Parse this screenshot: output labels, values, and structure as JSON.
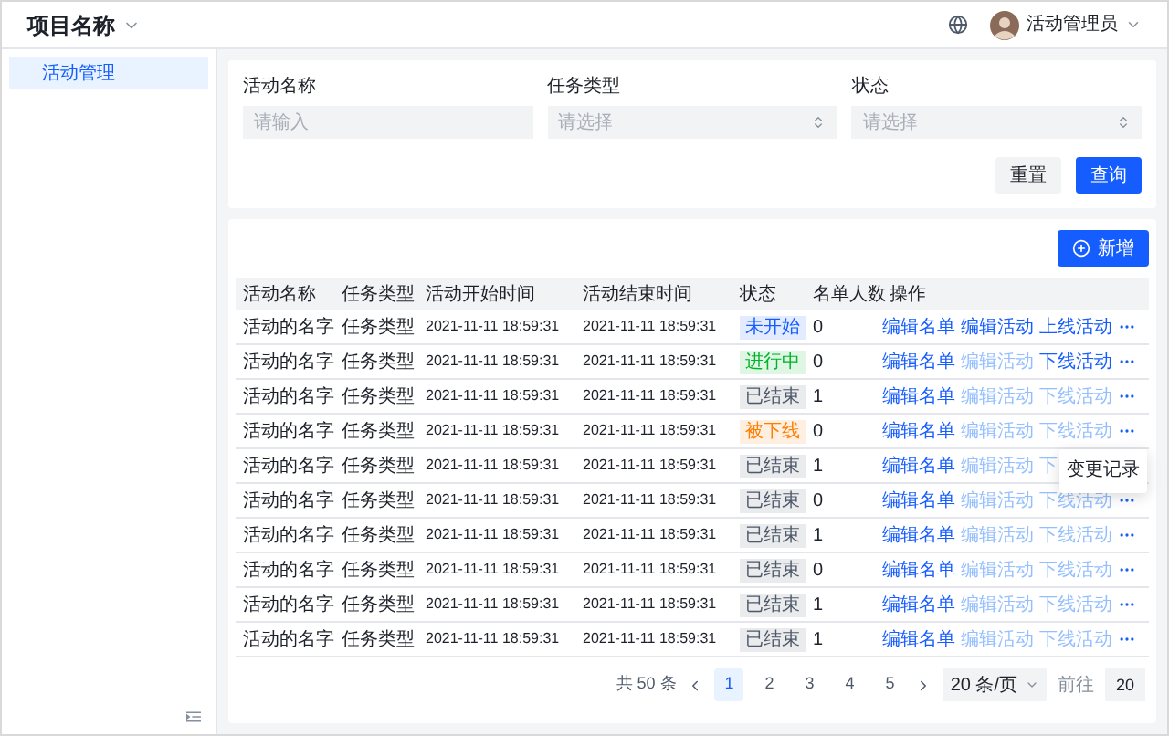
{
  "header": {
    "project": "项目名称",
    "user": "活动管理员"
  },
  "sidebar": {
    "items": [
      {
        "label": "活动管理",
        "selected": true
      }
    ]
  },
  "filters": {
    "fields": [
      {
        "label": "活动名称",
        "kind": "input",
        "placeholder": "请输入"
      },
      {
        "label": "任务类型",
        "kind": "select",
        "placeholder": "请选择"
      },
      {
        "label": "状态",
        "kind": "select",
        "placeholder": "请选择"
      }
    ],
    "buttons": [
      {
        "label": "重置",
        "kind": "secondary"
      },
      {
        "label": "查询",
        "kind": "primary"
      }
    ]
  },
  "table": {
    "add_button": "新增",
    "columns": [
      "活动名称",
      "任务类型",
      "活动开始时间",
      "活动结束时间",
      "状态",
      "名单人数",
      "操作"
    ],
    "rows": [
      {
        "name": "活动的名字",
        "type": "任务类型",
        "start": "2021-11-11 18:59:31",
        "end": "2021-11-11 18:59:31",
        "status": {
          "text": "未开始",
          "color": "#165dff"
        },
        "count": "0",
        "actions": [
          {
            "label": "编辑名单",
            "disabled": false
          },
          {
            "label": "编辑活动",
            "disabled": false
          },
          {
            "label": "上线活动",
            "disabled": false
          }
        ]
      },
      {
        "name": "活动的名字",
        "type": "任务类型",
        "start": "2021-11-11 18:59:31",
        "end": "2021-11-11 18:59:31",
        "status": {
          "text": "进行中",
          "color": "#00b42a"
        },
        "count": "0",
        "actions": [
          {
            "label": "编辑名单",
            "disabled": false
          },
          {
            "label": "编辑活动",
            "disabled": true
          },
          {
            "label": "下线活动",
            "disabled": false
          }
        ]
      },
      {
        "name": "活动的名字",
        "type": "任务类型",
        "start": "2021-11-11 18:59:31",
        "end": "2021-11-11 18:59:31",
        "status": {
          "text": "已结束",
          "color": "#4e5969"
        },
        "count": "1",
        "actions": [
          {
            "label": "编辑名单",
            "disabled": false
          },
          {
            "label": "编辑活动",
            "disabled": true
          },
          {
            "label": "下线活动",
            "disabled": true
          }
        ]
      },
      {
        "name": "活动的名字",
        "type": "任务类型",
        "start": "2021-11-11 18:59:31",
        "end": "2021-11-11 18:59:31",
        "status": {
          "text": "被下线",
          "color": "#ff7d00"
        },
        "count": "0",
        "actions": [
          {
            "label": "编辑名单",
            "disabled": false
          },
          {
            "label": "编辑活动",
            "disabled": true
          },
          {
            "label": "下线活动",
            "disabled": true
          }
        ],
        "menu": [
          "变更记录"
        ]
      },
      {
        "name": "活动的名字",
        "type": "任务类型",
        "start": "2021-11-11 18:59:31",
        "end": "2021-11-11 18:59:31",
        "status": {
          "text": "已结束",
          "color": "#4e5969"
        },
        "count": "1",
        "actions": [
          {
            "label": "编辑名单",
            "disabled": false
          },
          {
            "label": "编辑活动",
            "disabled": true
          },
          {
            "label": "下",
            "disabled": true
          }
        ],
        "more_hidden": true
      },
      {
        "name": "活动的名字",
        "type": "任务类型",
        "start": "2021-11-11 18:59:31",
        "end": "2021-11-11 18:59:31",
        "status": {
          "text": "已结束",
          "color": "#4e5969"
        },
        "count": "0",
        "actions": [
          {
            "label": "编辑名单",
            "disabled": false
          },
          {
            "label": "编辑活动",
            "disabled": true
          },
          {
            "label": "下线活动",
            "disabled": true
          }
        ]
      },
      {
        "name": "活动的名字",
        "type": "任务类型",
        "start": "2021-11-11 18:59:31",
        "end": "2021-11-11 18:59:31",
        "status": {
          "text": "已结束",
          "color": "#4e5969"
        },
        "count": "1",
        "actions": [
          {
            "label": "编辑名单",
            "disabled": false
          },
          {
            "label": "编辑活动",
            "disabled": true
          },
          {
            "label": "下线活动",
            "disabled": true
          }
        ]
      },
      {
        "name": "活动的名字",
        "type": "任务类型",
        "start": "2021-11-11 18:59:31",
        "end": "2021-11-11 18:59:31",
        "status": {
          "text": "已结束",
          "color": "#4e5969"
        },
        "count": "0",
        "actions": [
          {
            "label": "编辑名单",
            "disabled": false
          },
          {
            "label": "编辑活动",
            "disabled": true
          },
          {
            "label": "下线活动",
            "disabled": true
          }
        ]
      },
      {
        "name": "活动的名字",
        "type": "任务类型",
        "start": "2021-11-11 18:59:31",
        "end": "2021-11-11 18:59:31",
        "status": {
          "text": "已结束",
          "color": "#4e5969"
        },
        "count": "1",
        "actions": [
          {
            "label": "编辑名单",
            "disabled": false
          },
          {
            "label": "编辑活动",
            "disabled": true
          },
          {
            "label": "下线活动",
            "disabled": true
          }
        ]
      },
      {
        "name": "活动的名字",
        "type": "任务类型",
        "start": "2021-11-11 18:59:31",
        "end": "2021-11-11 18:59:31",
        "status": {
          "text": "已结束",
          "color": "#4e5969"
        },
        "count": "1",
        "actions": [
          {
            "label": "编辑名单",
            "disabled": false
          },
          {
            "label": "编辑活动",
            "disabled": true
          },
          {
            "label": "下线活动",
            "disabled": true
          }
        ]
      }
    ]
  },
  "pagination": {
    "total": "共 50 条",
    "pages": [
      {
        "label": "1",
        "selected": true
      },
      {
        "label": "2",
        "selected": false
      },
      {
        "label": "3",
        "selected": false
      },
      {
        "label": "4",
        "selected": false
      },
      {
        "label": "5",
        "selected": false
      }
    ],
    "page_size": "20 条/页",
    "goto_label": "前往",
    "goto_value": "20"
  }
}
